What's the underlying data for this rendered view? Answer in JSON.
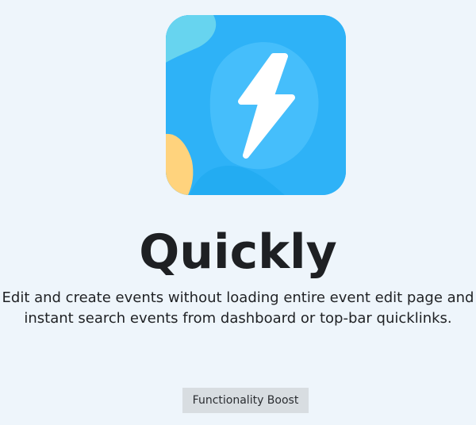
{
  "app": {
    "icon": "lightning-bolt-icon",
    "title": "Quickly",
    "description": "Edit and create events without loading entire event edit page and instant search events from dashboard or top-bar quicklinks.",
    "tag": "Functionality Boost"
  },
  "colors": {
    "background": "#eef5fb",
    "icon_primary": "#2eb2f7",
    "icon_light": "#67d4ef",
    "icon_accent": "#ffd37d",
    "tag_background": "#d8dde1",
    "title_text": "#1e2023"
  }
}
